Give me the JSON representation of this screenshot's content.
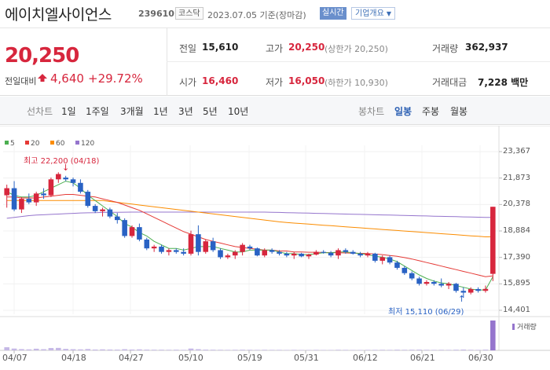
{
  "header": {
    "stock_name": "에이치엘사이언스",
    "stock_code": "239610",
    "market": "코스닥",
    "date": "2023.07.05 기준(장마감)",
    "realtime_label": "실시간",
    "company_label": "기업개요"
  },
  "price": {
    "current": "20,250",
    "diff_label": "전일대비",
    "diff_value": "4,640",
    "diff_pct": "+29.72%",
    "prev_label": "전일",
    "prev_value": "15,610",
    "open_label": "시가",
    "open_value": "16,460",
    "high_label": "고가",
    "high_value": "20,250",
    "high_sub": "(상한가 20,250)",
    "low_label": "저가",
    "low_value": "16,050",
    "low_sub": "(하한가 10,930)",
    "volume_label": "거래량",
    "volume_value": "362,937",
    "amount_label": "거래대금",
    "amount_value": "7,228 백만"
  },
  "tabs": {
    "line_chart": "선차트",
    "line_periods": [
      "1일",
      "1주일",
      "3개월",
      "1년",
      "3년",
      "5년",
      "10년"
    ],
    "candle_chart": "봉차트",
    "candle_periods": [
      "일봉",
      "주봉",
      "월봉"
    ],
    "active_candle": "일봉"
  },
  "legend": [
    {
      "label": "5",
      "color": "#4caf50"
    },
    {
      "label": "20",
      "color": "#e53935"
    },
    {
      "label": "60",
      "color": "#fb8c00"
    },
    {
      "label": "120",
      "color": "#9575cd"
    }
  ],
  "annotations": {
    "high": "최고 22,200 (04/18)",
    "low": "최저 15,110 (06/29)"
  },
  "volume_label": "거래량",
  "colors": {
    "up": "#d7263d",
    "down": "#2962c4",
    "accent": "#2b5fb3"
  },
  "chart_data": {
    "type": "candlestick",
    "x_ticks": [
      "04/07",
      "04/18",
      "04/27",
      "05/10",
      "05/19",
      "05/31",
      "06/12",
      "06/21",
      "06/30"
    ],
    "y_ticks": [
      23367,
      21873,
      20378,
      18884,
      17390,
      15895,
      14401
    ],
    "ylim": [
      14401,
      23367
    ],
    "candles": [
      [
        20900,
        21500,
        20200,
        21300
      ],
      [
        21300,
        21700,
        20000,
        20100
      ],
      [
        20100,
        20800,
        19900,
        20700
      ],
      [
        20700,
        21000,
        20400,
        20500
      ],
      [
        20500,
        21100,
        20300,
        21000
      ],
      [
        21000,
        21300,
        20700,
        20900
      ],
      [
        20900,
        21900,
        20800,
        21800
      ],
      [
        21800,
        22200,
        21600,
        22100
      ],
      [
        21900,
        22000,
        21700,
        21800
      ],
      [
        21800,
        21900,
        21400,
        21600
      ],
      [
        21600,
        21800,
        21000,
        21100
      ],
      [
        21100,
        21200,
        20200,
        20300
      ],
      [
        20300,
        20400,
        19900,
        20000
      ],
      [
        20000,
        20200,
        19700,
        20100
      ],
      [
        20100,
        20200,
        19600,
        19700
      ],
      [
        19700,
        19900,
        19300,
        19500
      ],
      [
        19500,
        19600,
        18500,
        18600
      ],
      [
        18600,
        19200,
        18500,
        19100
      ],
      [
        19100,
        19300,
        18300,
        18400
      ],
      [
        18400,
        18500,
        17800,
        17900
      ],
      [
        17900,
        18100,
        17700,
        18000
      ],
      [
        18000,
        18100,
        17600,
        17700
      ],
      [
        17700,
        17900,
        17500,
        17800
      ],
      [
        17800,
        17900,
        17600,
        17700
      ],
      [
        17700,
        17900,
        17500,
        17600
      ],
      [
        17600,
        18900,
        17500,
        18700
      ],
      [
        18700,
        19200,
        17500,
        17700
      ],
      [
        17700,
        18400,
        17600,
        18300
      ],
      [
        18300,
        18500,
        17700,
        17800
      ],
      [
        17800,
        17900,
        17300,
        17400
      ],
      [
        17400,
        17600,
        17300,
        17500
      ],
      [
        17500,
        17800,
        17300,
        17700
      ],
      [
        17700,
        18200,
        17500,
        18100
      ],
      [
        18000,
        18100,
        17800,
        17900
      ],
      [
        17900,
        17950,
        17450,
        17500
      ],
      [
        17500,
        17900,
        17400,
        17800
      ],
      [
        17800,
        17900,
        17600,
        17700
      ],
      [
        17700,
        17800,
        17500,
        17600
      ],
      [
        17600,
        17700,
        17400,
        17500
      ],
      [
        17500,
        17700,
        17300,
        17600
      ],
      [
        17600,
        17650,
        17400,
        17450
      ],
      [
        17450,
        17600,
        17300,
        17550
      ],
      [
        17550,
        17800,
        17500,
        17700
      ],
      [
        17700,
        17800,
        17600,
        17650
      ],
      [
        17650,
        17750,
        17400,
        17500
      ],
      [
        17500,
        17900,
        17300,
        17800
      ],
      [
        17800,
        17900,
        17600,
        17700
      ],
      [
        17700,
        17800,
        17550,
        17600
      ],
      [
        17600,
        17700,
        17400,
        17500
      ],
      [
        17500,
        17700,
        17400,
        17600
      ],
      [
        17600,
        17650,
        17100,
        17200
      ],
      [
        17200,
        17500,
        17000,
        17400
      ],
      [
        17400,
        17500,
        17000,
        17100
      ],
      [
        17100,
        17200,
        16700,
        16800
      ],
      [
        16800,
        16900,
        16400,
        16500
      ],
      [
        16500,
        16600,
        16100,
        16200
      ],
      [
        16200,
        16300,
        15800,
        15900
      ],
      [
        15900,
        16100,
        15800,
        16000
      ],
      [
        16000,
        16100,
        15800,
        15900
      ],
      [
        15900,
        16200,
        15700,
        15800
      ],
      [
        15800,
        16000,
        15600,
        15900
      ],
      [
        15900,
        15950,
        15400,
        15500
      ],
      [
        15500,
        15700,
        15110,
        15400
      ],
      [
        15400,
        15700,
        15300,
        15600
      ],
      [
        15600,
        15700,
        15400,
        15500
      ],
      [
        15500,
        15800,
        15400,
        15610
      ],
      [
        16460,
        20250,
        16050,
        20250
      ]
    ],
    "ma5": [
      21100,
      20900,
      20800,
      20800,
      20900,
      21100,
      21300,
      21500,
      21700,
      21600,
      21300,
      20900,
      20600,
      20300,
      20000,
      19700,
      19300,
      19100,
      18800,
      18600,
      18300,
      18100,
      17900,
      17900,
      17800,
      17900,
      18000,
      18000,
      18000,
      17900,
      17800,
      17700,
      17700,
      17800,
      17800,
      17800,
      17800,
      17700,
      17600,
      17600,
      17550,
      17550,
      17600,
      17650,
      17650,
      17700,
      17700,
      17650,
      17600,
      17550,
      17450,
      17400,
      17300,
      17150,
      16900,
      16650,
      16400,
      16200,
      16050,
      15950,
      15900,
      15800,
      15700,
      15600,
      15550,
      15550,
      16300
    ],
    "ma20": [
      20800,
      20800,
      20750,
      20750,
      20750,
      20800,
      20850,
      20900,
      20950,
      20950,
      20900,
      20850,
      20800,
      20700,
      20600,
      20500,
      20350,
      20200,
      20050,
      19850,
      19650,
      19450,
      19250,
      19050,
      18850,
      18700,
      18550,
      18400,
      18300,
      18200,
      18100,
      18000,
      17950,
      17900,
      17850,
      17800,
      17800,
      17750,
      17750,
      17700,
      17700,
      17680,
      17680,
      17670,
      17660,
      17650,
      17640,
      17630,
      17620,
      17610,
      17580,
      17550,
      17500,
      17450,
      17380,
      17300,
      17200,
      17100,
      17000,
      16900,
      16800,
      16700,
      16600,
      16500,
      16400,
      16300,
      16350
    ],
    "ma60": [
      20600,
      20600,
      20600,
      20600,
      20600,
      20600,
      20600,
      20600,
      20600,
      20600,
      20600,
      20600,
      20600,
      20600,
      20550,
      20500,
      20450,
      20400,
      20350,
      20300,
      20250,
      20200,
      20150,
      20100,
      20050,
      20000,
      19950,
      19900,
      19850,
      19800,
      19750,
      19700,
      19650,
      19600,
      19550,
      19500,
      19450,
      19400,
      19360,
      19330,
      19300,
      19270,
      19240,
      19210,
      19180,
      19150,
      19120,
      19090,
      19060,
      19030,
      19000,
      18970,
      18940,
      18910,
      18880,
      18850,
      18820,
      18790,
      18760,
      18730,
      18700,
      18670,
      18640,
      18610,
      18580,
      18550,
      18550
    ],
    "ma120": [
      19600,
      19650,
      19700,
      19750,
      19780,
      19800,
      19820,
      19840,
      19860,
      19880,
      19900,
      19910,
      19920,
      19930,
      19935,
      19940,
      19945,
      19950,
      19950,
      19950,
      19950,
      19950,
      19950,
      19950,
      19950,
      19950,
      19950,
      19950,
      19950,
      19950,
      19950,
      19950,
      19950,
      19950,
      19950,
      19950,
      19940,
      19930,
      19920,
      19910,
      19900,
      19890,
      19880,
      19870,
      19860,
      19850,
      19840,
      19830,
      19820,
      19810,
      19800,
      19790,
      19780,
      19770,
      19760,
      19750,
      19740,
      19730,
      19720,
      19710,
      19700,
      19690,
      19680,
      19670,
      19660,
      19650,
      19650
    ],
    "volume": [
      38,
      22,
      15,
      12,
      20,
      14,
      28,
      30,
      18,
      14,
      12,
      16,
      10,
      12,
      10,
      9,
      14,
      10,
      12,
      9,
      8,
      8,
      7,
      8,
      6,
      22,
      14,
      9,
      8,
      7,
      6,
      7,
      8,
      7,
      6,
      7,
      6,
      6,
      5,
      6,
      5,
      5,
      6,
      5,
      5,
      7,
      6,
      5,
      5,
      6,
      6,
      7,
      6,
      8,
      7,
      8,
      9,
      7,
      6,
      7,
      6,
      8,
      10,
      7,
      6,
      9,
      363
    ]
  }
}
